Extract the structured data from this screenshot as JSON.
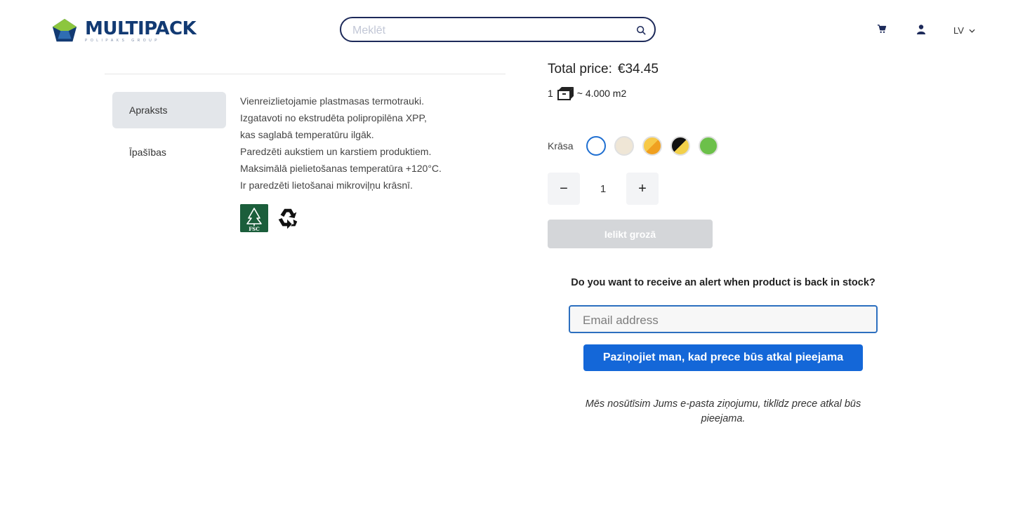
{
  "header": {
    "logo_text": "MULTIPACK",
    "logo_subtext": "POLIPAKS GROUP",
    "search_placeholder": "Meklēt",
    "language": "LV"
  },
  "tabs": [
    {
      "label": "Apraksts",
      "active": true
    },
    {
      "label": "Īpašības",
      "active": false
    }
  ],
  "description": [
    "Vienreizlietojamie plastmasas termotrauki.",
    "Izgatavoti no ekstrudēta polipropilēna XPP,",
    "kas saglabā temperatūru ilgāk.",
    "Paredzēti aukstiem un karstiem produktiem.",
    "Maksimālā pielietošanas temperatūra +120°C.",
    "Ir paredzēti lietošanai mikroviļņu krāsnī."
  ],
  "badges": {
    "fsc": "FSC"
  },
  "product": {
    "total_label": "Total price:",
    "total_value": "€34.45",
    "pack_qty": "1",
    "pack_area": "~ 4.000 m2",
    "color_label": "Krāsa",
    "swatches": [
      {
        "name": "white",
        "colors": [
          "#ffffff"
        ],
        "selected": true
      },
      {
        "name": "cream",
        "colors": [
          "#efe6d6"
        ]
      },
      {
        "name": "orange-yellow",
        "colors": [
          "#f7c948",
          "#f0a020"
        ]
      },
      {
        "name": "black-yellow",
        "colors": [
          "#111111",
          "#f2d04a"
        ]
      },
      {
        "name": "green",
        "colors": [
          "#6cc04a"
        ]
      }
    ],
    "quantity": "1",
    "minus": "−",
    "plus": "+",
    "add_to_cart": "Ielikt grozā"
  },
  "stock_alert": {
    "question": "Do you want to receive an alert when product is back in stock?",
    "email_placeholder": "Email address",
    "button": "Paziņojiet man, kad prece būs atkal pieejama",
    "note": "Mēs nosūtīsim Jums e-pasta ziņojumu, tiklīdz prece atkal būs pieejama."
  },
  "colors": {
    "brand_navy": "#123a73",
    "brand_green": "#8cc63f",
    "accent_blue": "#1467d8",
    "disabled_gray": "#d4d6d9"
  }
}
